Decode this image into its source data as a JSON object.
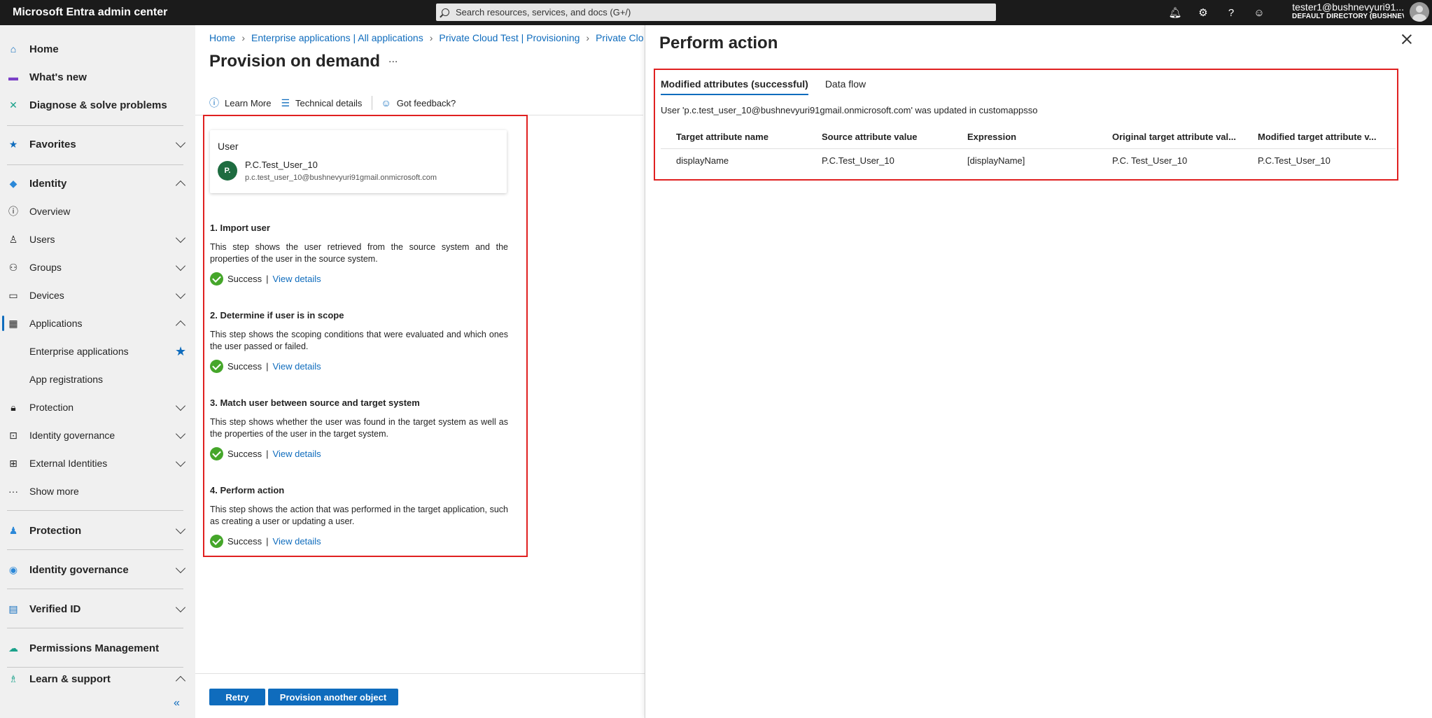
{
  "topbar": {
    "brand": "Microsoft Entra admin center",
    "search_placeholder": "Search resources, services, and docs (G+/)",
    "account_name": "tester1@bushnevyuri91...",
    "account_directory": "DEFAULT DIRECTORY (BUSHNEV..."
  },
  "sidebar": {
    "home": "Home",
    "whats_new": "What's new",
    "diagnose": "Diagnose & solve problems",
    "favorites": "Favorites",
    "identity": "Identity",
    "overview": "Overview",
    "users": "Users",
    "groups": "Groups",
    "devices": "Devices",
    "applications": "Applications",
    "enterprise_apps": "Enterprise applications",
    "app_registrations": "App registrations",
    "protection_sub": "Protection",
    "identity_governance_sub": "Identity governance",
    "external_identities": "External Identities",
    "show_more": "Show more",
    "protection": "Protection",
    "identity_governance": "Identity governance",
    "verified_id": "Verified ID",
    "permissions_management": "Permissions Management",
    "learn_support": "Learn & support"
  },
  "breadcrumb": [
    "Home",
    "Enterprise applications | All applications",
    "Private Cloud Test | Provisioning",
    "Private Cloud"
  ],
  "page": {
    "title": "Provision on demand",
    "more": "...",
    "toolbar": {
      "learn_more": "Learn More",
      "technical_details": "Technical details",
      "feedback": "Got feedback?"
    }
  },
  "user_card": {
    "header": "User",
    "initials": "P.",
    "name": "P.C.Test_User_10",
    "email": "p.c.test_user_10@bushnevyuri91gmail.onmicrosoft.com"
  },
  "steps": [
    {
      "title": "1. Import user",
      "description": "This step shows the user retrieved from the source system and the properties of the user in the source system.",
      "status": "Success",
      "link": "View details"
    },
    {
      "title": "2. Determine if user is in scope",
      "description": "This step shows the scoping conditions that were evaluated and which ones the user passed or failed.",
      "status": "Success",
      "link": "View details"
    },
    {
      "title": "3. Match user between source and target system",
      "description": "This step shows whether the user was found in the target system as well as the properties of the user in the target system.",
      "status": "Success",
      "link": "View details"
    },
    {
      "title": "4. Perform action",
      "description": "This step shows the action that was performed in the target application, such as creating a user or updating a user.",
      "status": "Success",
      "link": "View details"
    }
  ],
  "buttons": {
    "retry": "Retry",
    "provision_another": "Provision another object"
  },
  "panel": {
    "title": "Perform action",
    "tabs": [
      "Modified attributes (successful)",
      "Data flow"
    ],
    "message": "User 'p.c.test_user_10@bushnevyuri91gmail.onmicrosoft.com' was updated in customappsso",
    "table": {
      "headers": [
        "Target attribute name",
        "Source attribute value",
        "Expression",
        "Original target attribute val...",
        "Modified target attribute v..."
      ],
      "rows": [
        [
          "displayName",
          "P.C.Test_User_10",
          "[displayName]",
          "P.C. Test_User_10",
          "P.C.Test_User_10"
        ]
      ]
    }
  },
  "colors": {
    "accent": "#0f6cbd",
    "highlight_border": "#e02020",
    "success": "#45a62a",
    "topbar": "#1b1b1b"
  }
}
